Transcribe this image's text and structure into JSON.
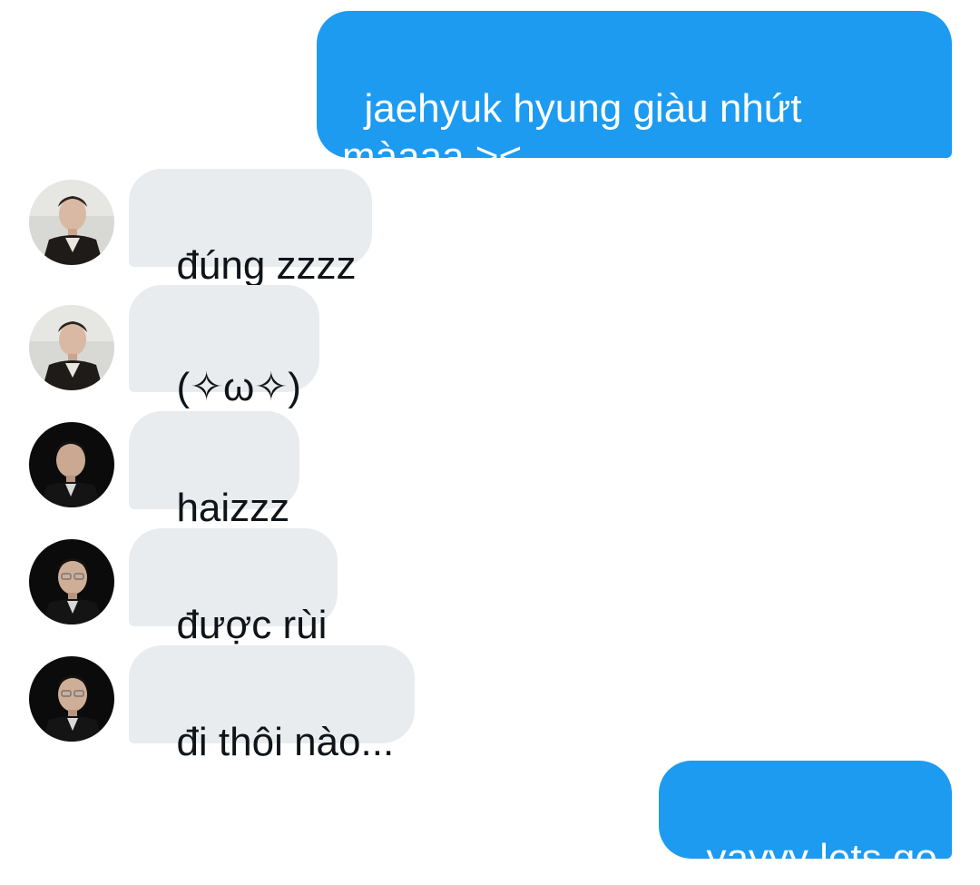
{
  "conversation": {
    "messages": [
      {
        "sender": "me",
        "text": "jaehyuk hyung giàu nhứt\nmàaaa ><"
      },
      {
        "sender": "other",
        "avatar": "avatar-light-photo",
        "text": "đúng zzzz"
      },
      {
        "sender": "other",
        "avatar": "avatar-light-photo",
        "text": "(✧ω✧)"
      },
      {
        "sender": "other",
        "avatar": "avatar-dark-photo",
        "text": "haizzz"
      },
      {
        "sender": "other",
        "avatar": "avatar-dark-photo",
        "text": "được rùi"
      },
      {
        "sender": "other",
        "avatar": "avatar-dark-photo",
        "text": "đi thôi nào..."
      },
      {
        "sender": "me",
        "text": "yayyy lets go"
      }
    ]
  },
  "colors": {
    "sent_bubble": "#1d9bf0",
    "received_bubble": "#e8ecef",
    "sent_text": "#ffffff",
    "received_text": "#0f1419"
  }
}
